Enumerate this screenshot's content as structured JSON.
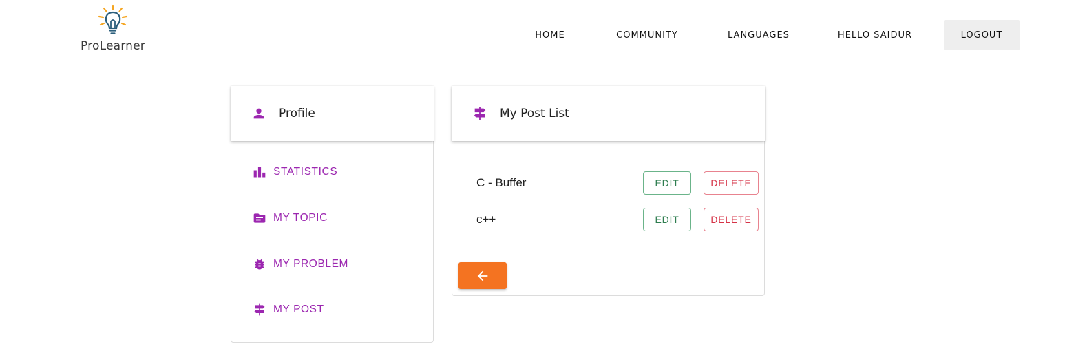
{
  "brand": {
    "name": "ProLearner"
  },
  "nav": {
    "home": "HOME",
    "community": "COMMUNITY",
    "languages": "LANGUAGES",
    "greeting": "HELLO SAIDUR",
    "logout": "LOGOUT"
  },
  "profile_card": {
    "title": "Profile",
    "icon": "person-icon",
    "items": [
      {
        "label": "STATISTICS",
        "icon": "bar-chart-icon"
      },
      {
        "label": "MY TOPIC",
        "icon": "folder-icon"
      },
      {
        "label": "MY PROBLEM",
        "icon": "bug-icon"
      },
      {
        "label": "MY POST",
        "icon": "signpost-icon"
      }
    ]
  },
  "post_card": {
    "title": "My Post List",
    "icon": "signpost-icon",
    "posts": [
      {
        "title": "C - Buffer",
        "edit_label": "EDIT",
        "delete_label": "DELETE"
      },
      {
        "title": "c++",
        "edit_label": "EDIT",
        "delete_label": "DELETE"
      }
    ],
    "back_icon": "arrow-left-icon"
  },
  "colors": {
    "accent_purple": "#9c27b0",
    "back_button": "#f47321",
    "edit_border": "#6bb48a",
    "delete_border": "#e8838f",
    "logout_bg": "#eeeeee"
  }
}
